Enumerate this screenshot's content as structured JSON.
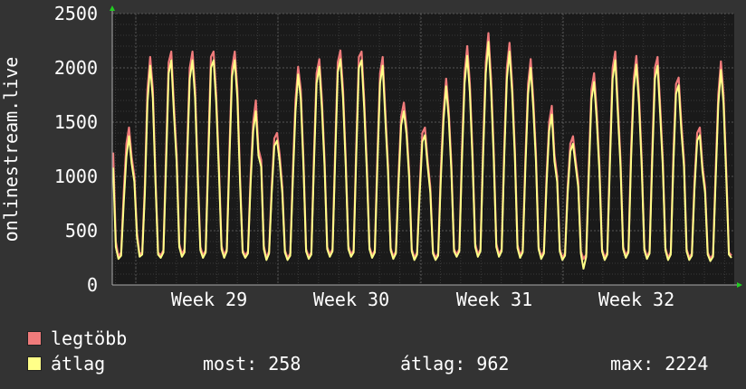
{
  "chart_data": {
    "type": "line",
    "ylabel": "onlinestream.live",
    "ylim": [
      0,
      2500
    ],
    "yticks": [
      0,
      500,
      1000,
      1500,
      2000,
      2500
    ],
    "x_tick_labels": [
      "Week 29",
      "Week 30",
      "Week 31",
      "Week 32"
    ],
    "grid": true,
    "colors": {
      "background": "#333333",
      "plot_area": "#1a1a1a",
      "grid_minor": "#3a3a3a",
      "grid_major": "#555555",
      "max_series": "#f07b7b",
      "avg_series": "#ffff88",
      "axis_arrow": "#22cc22"
    },
    "series": [
      {
        "name": "legtöbb",
        "values": [
          1220,
          400,
          260,
          300,
          850,
          1300,
          1450,
          1180,
          1000,
          480,
          280,
          300,
          920,
          1800,
          2100,
          1800,
          1000,
          300,
          270,
          320,
          1200,
          2050,
          2150,
          1650,
          1200,
          380,
          280,
          330,
          1250,
          2000,
          2150,
          1800,
          1050,
          350,
          270,
          320,
          1260,
          2100,
          2150,
          1750,
          1100,
          360,
          270,
          330,
          1240,
          2000,
          2150,
          1800,
          1000,
          320,
          270,
          310,
          1000,
          1500,
          1700,
          1250,
          1150,
          360,
          250,
          310,
          900,
          1350,
          1400,
          1200,
          900,
          320,
          250,
          290,
          1050,
          1700,
          2010,
          1800,
          1150,
          330,
          260,
          300,
          1200,
          1950,
          2080,
          1700,
          1150,
          350,
          280,
          330,
          1240,
          2050,
          2160,
          1800,
          1150,
          360,
          280,
          320,
          1280,
          2100,
          2150,
          1700,
          1100,
          350,
          270,
          320,
          1200,
          1950,
          2100,
          1600,
          1100,
          340,
          260,
          310,
          1000,
          1550,
          1680,
          1450,
          1050,
          330,
          250,
          300,
          900,
          1400,
          1450,
          1150,
          900,
          310,
          250,
          290,
          1050,
          1600,
          1900,
          1600,
          1100,
          330,
          280,
          330,
          1250,
          1950,
          2200,
          1850,
          1200,
          380,
          280,
          330,
          1270,
          2050,
          2320,
          1900,
          1250,
          380,
          280,
          330,
          1270,
          2000,
          2230,
          1850,
          1250,
          370,
          270,
          320,
          1150,
          1850,
          2080,
          1700,
          1200,
          350,
          260,
          310,
          1000,
          1500,
          1650,
          1200,
          1000,
          330,
          250,
          290,
          900,
          1300,
          1370,
          1150,
          950,
          310,
          240,
          280,
          1100,
          1800,
          1950,
          1600,
          1100,
          330,
          250,
          300,
          1200,
          2000,
          2150,
          1650,
          1150,
          350,
          270,
          320,
          1250,
          1900,
          2110,
          1750,
          1150,
          340,
          260,
          310,
          1220,
          2000,
          2100,
          1650,
          1150,
          340,
          250,
          300,
          1200,
          1850,
          1910,
          1500,
          1150,
          330,
          250,
          290,
          950,
          1400,
          1450,
          1100,
          900,
          300,
          240,
          280,
          1050,
          1750,
          2060,
          1750,
          1050,
          300,
          270
        ],
        "peaks_summary": [
          1450,
          2120,
          2150,
          2150,
          2150,
          2130,
          1700,
          1420,
          2010,
          2080,
          2160,
          2150,
          2100,
          1680,
          1450,
          1900,
          2200,
          2320,
          2230,
          2080,
          1650,
          1370,
          1950,
          2150,
          2110,
          2100,
          1910,
          1450,
          2060
        ]
      },
      {
        "name": "átlag",
        "values": [
          1080,
          350,
          240,
          270,
          760,
          1180,
          1370,
          1120,
          950,
          440,
          260,
          280,
          840,
          1680,
          2020,
          1720,
          950,
          280,
          250,
          300,
          1100,
          1950,
          2070,
          1580,
          1130,
          350,
          260,
          300,
          1150,
          1900,
          2070,
          1720,
          990,
          320,
          250,
          300,
          1160,
          2000,
          2070,
          1680,
          1040,
          330,
          250,
          310,
          1150,
          1920,
          2070,
          1720,
          950,
          300,
          250,
          290,
          930,
          1420,
          1600,
          1190,
          1090,
          330,
          230,
          290,
          840,
          1280,
          1330,
          1140,
          850,
          300,
          230,
          270,
          970,
          1600,
          1940,
          1720,
          1090,
          310,
          240,
          280,
          1110,
          1860,
          2010,
          1620,
          1090,
          330,
          260,
          310,
          1150,
          1960,
          2080,
          1720,
          1090,
          330,
          260,
          300,
          1190,
          2000,
          2070,
          1620,
          1040,
          330,
          250,
          300,
          1110,
          1860,
          2020,
          1530,
          1040,
          320,
          240,
          290,
          930,
          1470,
          1600,
          1390,
          990,
          310,
          230,
          280,
          840,
          1320,
          1380,
          1100,
          850,
          290,
          230,
          270,
          970,
          1520,
          1830,
          1530,
          1040,
          310,
          260,
          310,
          1160,
          1860,
          2110,
          1770,
          1130,
          350,
          260,
          310,
          1180,
          1950,
          2240,
          1810,
          1180,
          350,
          260,
          310,
          1180,
          1900,
          2150,
          1770,
          1180,
          340,
          250,
          300,
          1070,
          1760,
          2000,
          1620,
          1130,
          330,
          240,
          290,
          930,
          1420,
          1570,
          1140,
          950,
          310,
          230,
          270,
          840,
          1230,
          1300,
          1100,
          900,
          290,
          150,
          260,
          1020,
          1710,
          1870,
          1520,
          1040,
          310,
          230,
          280,
          1110,
          1900,
          2070,
          1570,
          1090,
          330,
          250,
          300,
          1160,
          1810,
          2030,
          1670,
          1090,
          320,
          240,
          290,
          1130,
          1900,
          2020,
          1570,
          1090,
          320,
          230,
          280,
          1110,
          1760,
          1840,
          1430,
          1090,
          310,
          230,
          270,
          880,
          1330,
          1380,
          1050,
          850,
          280,
          220,
          260,
          970,
          1660,
          1980,
          1670,
          990,
          280,
          250
        ]
      }
    ]
  },
  "legend": {
    "max_label": "legtöbb",
    "avg_label": "átlag"
  },
  "stats": {
    "current": "most: 258",
    "average": "átlag: 962",
    "maximum": "max: 2224"
  }
}
